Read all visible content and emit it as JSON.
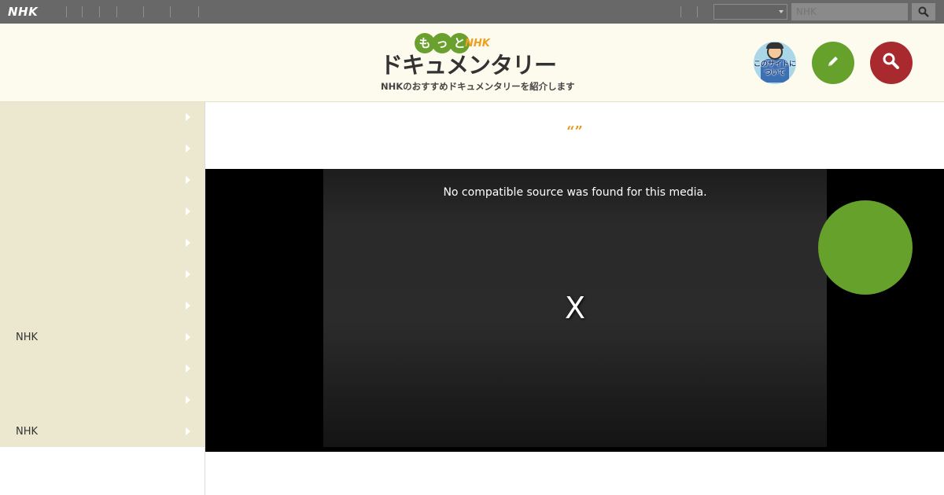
{
  "topbar": {
    "logo": "NHK",
    "search_placeholder": "NHK",
    "select_value": ""
  },
  "header": {
    "logo_motto": [
      "も",
      "っ",
      "と"
    ],
    "logo_nhk": "NHK",
    "logo_main": "ドキュメンタリー",
    "logo_sub": "NHKのおすすめドキュメンタリーを紹介します",
    "about_label": "このサイトについて",
    "icons": [
      "pencil-icon",
      "search-icon"
    ]
  },
  "sidebar": {
    "items": [
      {
        "label": ""
      },
      {
        "label": ""
      },
      {
        "label": ""
      },
      {
        "label": ""
      },
      {
        "label": ""
      },
      {
        "label": ""
      },
      {
        "label": ""
      },
      {
        "label": "NHK"
      },
      {
        "label": ""
      },
      {
        "label": ""
      },
      {
        "label": "NHK"
      }
    ]
  },
  "main": {
    "title": "“”",
    "video": {
      "error_message": "No compatible source was found for this media.",
      "close_label": "X"
    }
  },
  "colors": {
    "topbar": "#686868",
    "header_bg": "#fdfbed",
    "sidebar_bg": "#ece8d0",
    "accent_green": "#66a12c",
    "accent_red": "#a8292e",
    "title_orange": "#e59a1c"
  }
}
